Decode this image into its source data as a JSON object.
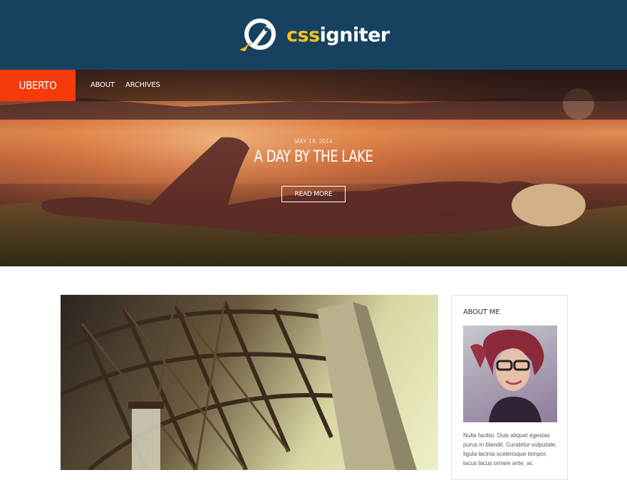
{
  "brand": {
    "name_prefix": "css",
    "name_suffix": "igniter",
    "logo_icon": "rocket-icon",
    "colors": {
      "bar": "#17425f",
      "accent": "#f9c21b"
    }
  },
  "site": {
    "title": "UBERTO",
    "title_color": "#f63a0c",
    "nav": [
      {
        "label": "ABOUT"
      },
      {
        "label": "ARCHIVES"
      }
    ]
  },
  "hero": {
    "date": "MAY 19, 2014",
    "title": "A DAY BY THE LAKE",
    "button_label": "READ MORE"
  },
  "sidebar": {
    "widget_title": "ABOUT ME",
    "about_text": "Nulla facilisi. Duis aliquet egestas purus in blandit. Curabitur vulputate, ligula lacinia scelerisque tempor, lacus lacus ornare ante, ac"
  }
}
